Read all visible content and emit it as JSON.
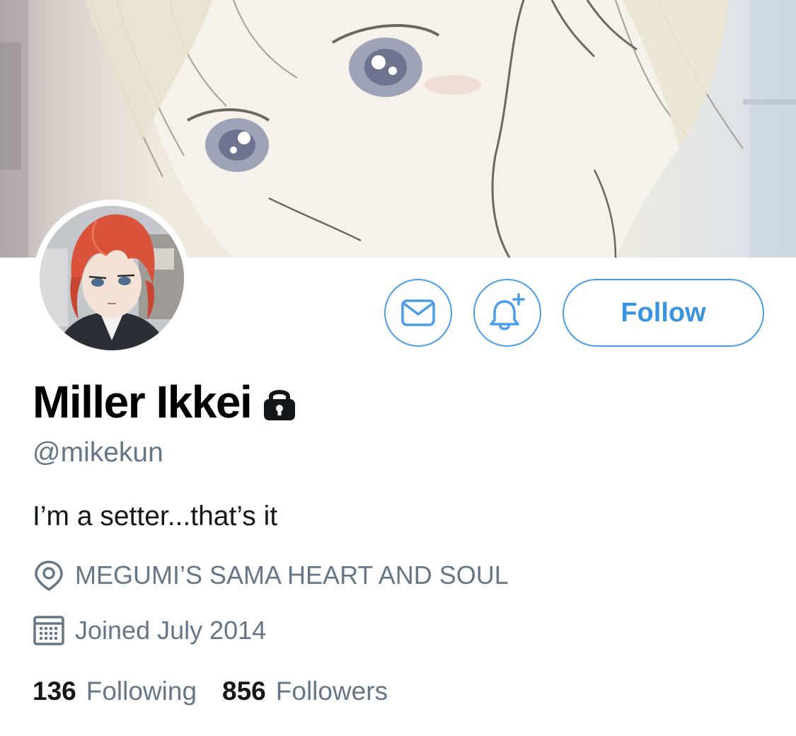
{
  "profile": {
    "display_name": "Miller Ikkei",
    "handle": "@mikekun",
    "bio": "I’m a setter...that’s it",
    "location": "MEGUMI’S SAMA HEART AND SOUL",
    "joined": "Joined July 2014",
    "protected": true
  },
  "actions": {
    "message_icon": "envelope-icon",
    "notify_icon": "bell-plus-icon",
    "follow_label": "Follow"
  },
  "stats": {
    "following_count": "136",
    "following_label": "Following",
    "followers_count": "856",
    "followers_label": "Followers"
  },
  "icons": {
    "lock": "lock-icon",
    "location": "location-pin-icon",
    "calendar": "calendar-icon"
  },
  "colors": {
    "accent": "#4a9de8",
    "secondary_text": "#657786",
    "primary_text": "#14171a"
  }
}
